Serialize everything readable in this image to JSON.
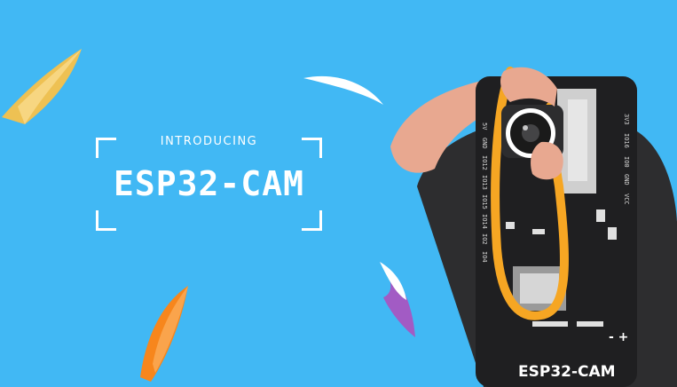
{
  "banner": {
    "intro_text": "INTRODUCING",
    "title": "ESP32-CAM",
    "board_label": "ESP32-CAM",
    "pins_left": [
      "5V",
      "GND",
      "IO12",
      "IO13",
      "IO15",
      "IO14",
      "IO2",
      "IO4"
    ],
    "pins_right": [
      "3V3",
      "IO16",
      "IO0",
      "GND",
      "VCC"
    ],
    "polarity": "- +"
  },
  "colors": {
    "background": "#41b8f4",
    "skin": "#e8a890",
    "shirt": "#2d2d2f",
    "strap": "#f6a623",
    "confetti_yellow": "#f8c14a",
    "confetti_orange": "#f7861c",
    "confetti_purple": "#a25bc4"
  }
}
